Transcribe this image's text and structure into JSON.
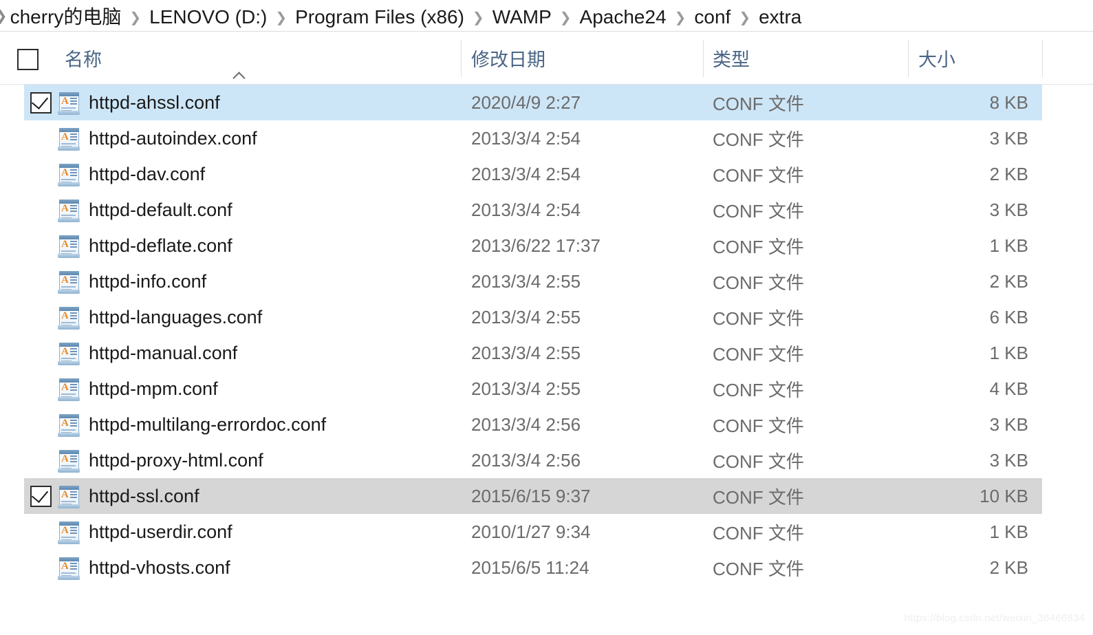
{
  "breadcrumb": {
    "separator": "❯",
    "lead_chevron": "❯",
    "items": [
      "cherry的电脑",
      "LENOVO (D:)",
      "Program Files (x86)",
      "WAMP",
      "Apache24",
      "conf",
      "extra"
    ]
  },
  "columns": {
    "name": "名称",
    "date_modified": "修改日期",
    "type": "类型",
    "size": "大小",
    "sort_indicator": "ascending",
    "select_all_checked": false
  },
  "colors": {
    "header_text": "#4a6585",
    "selection_focused": "#cde6f7",
    "selection_unfocused": "#d6d6d6",
    "body_text": "#1a1a1a",
    "secondary_text": "#6b6b6b",
    "icon_letter": "#e8892b"
  },
  "files": [
    {
      "name": "httpd-ahssl.conf",
      "date": "2020/4/9 2:27",
      "type": "CONF 文件",
      "size": "8 KB",
      "icon": "conf-file-icon",
      "checked": true,
      "state": "selected"
    },
    {
      "name": "httpd-autoindex.conf",
      "date": "2013/3/4 2:54",
      "type": "CONF 文件",
      "size": "3 KB",
      "icon": "conf-file-icon",
      "checked": false,
      "state": "normal"
    },
    {
      "name": "httpd-dav.conf",
      "date": "2013/3/4 2:54",
      "type": "CONF 文件",
      "size": "2 KB",
      "icon": "conf-file-icon",
      "checked": false,
      "state": "normal"
    },
    {
      "name": "httpd-default.conf",
      "date": "2013/3/4 2:54",
      "type": "CONF 文件",
      "size": "3 KB",
      "icon": "conf-file-icon",
      "checked": false,
      "state": "normal"
    },
    {
      "name": "httpd-deflate.conf",
      "date": "2013/6/22 17:37",
      "type": "CONF 文件",
      "size": "1 KB",
      "icon": "conf-file-icon",
      "checked": false,
      "state": "normal"
    },
    {
      "name": "httpd-info.conf",
      "date": "2013/3/4 2:55",
      "type": "CONF 文件",
      "size": "2 KB",
      "icon": "conf-file-icon",
      "checked": false,
      "state": "normal"
    },
    {
      "name": "httpd-languages.conf",
      "date": "2013/3/4 2:55",
      "type": "CONF 文件",
      "size": "6 KB",
      "icon": "conf-file-icon",
      "checked": false,
      "state": "normal"
    },
    {
      "name": "httpd-manual.conf",
      "date": "2013/3/4 2:55",
      "type": "CONF 文件",
      "size": "1 KB",
      "icon": "conf-file-icon",
      "checked": false,
      "state": "normal"
    },
    {
      "name": "httpd-mpm.conf",
      "date": "2013/3/4 2:55",
      "type": "CONF 文件",
      "size": "4 KB",
      "icon": "conf-file-icon",
      "checked": false,
      "state": "normal"
    },
    {
      "name": "httpd-multilang-errordoc.conf",
      "date": "2013/3/4 2:56",
      "type": "CONF 文件",
      "size": "3 KB",
      "icon": "conf-file-icon",
      "checked": false,
      "state": "normal"
    },
    {
      "name": "httpd-proxy-html.conf",
      "date": "2013/3/4 2:56",
      "type": "CONF 文件",
      "size": "3 KB",
      "icon": "conf-file-icon",
      "checked": false,
      "state": "normal"
    },
    {
      "name": "httpd-ssl.conf",
      "date": "2015/6/15 9:37",
      "type": "CONF 文件",
      "size": "10 KB",
      "icon": "conf-file-icon",
      "checked": true,
      "state": "selected-unfocused"
    },
    {
      "name": "httpd-userdir.conf",
      "date": "2010/1/27 9:34",
      "type": "CONF 文件",
      "size": "1 KB",
      "icon": "conf-file-icon",
      "checked": false,
      "state": "normal"
    },
    {
      "name": "httpd-vhosts.conf",
      "date": "2015/6/5 11:24",
      "type": "CONF 文件",
      "size": "2 KB",
      "icon": "conf-file-icon",
      "checked": false,
      "state": "normal"
    }
  ],
  "watermark": "https://blog.csdn.net/weixin_36466834"
}
